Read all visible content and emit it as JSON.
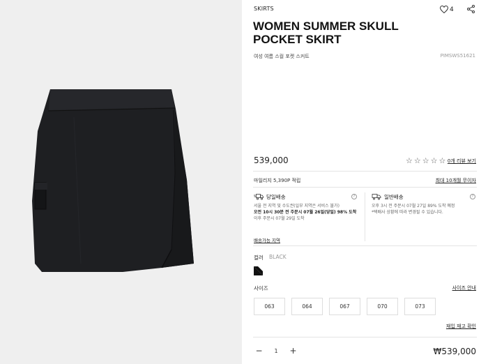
{
  "product": {
    "category": "SKIRTS",
    "wish_count": "4",
    "title_line1": "WOMEN SUMMER SKULL",
    "title_line2": "POCKET SKIRT",
    "subtitle": "여성 여름 스컬 포켓 스커트",
    "sku": "PIMSWS51621",
    "price": "539,000",
    "rating_stars": 0,
    "review_link": "0개 리뷰 보기"
  },
  "benefits": {
    "mileage": "마일리지 5,390P 적립",
    "installment_link": "최대 10개월 무이자"
  },
  "shipping": {
    "same_day": {
      "title": "당일배송",
      "line1": "서울 전 지역 및 수도권(일부 지역은 서비스 불가)",
      "line2": "오전 10시 30분 전 주문시 07월 26일(당일) 98% 도착",
      "line3": "이후 주문시 07월 29일 도착"
    },
    "regular": {
      "title": "일반배송",
      "line1": "오후 3시 전 주문시 07월 27일 89% 도착 예정",
      "line2": "*택배사 상황에 따라 변경될 수 있습니다."
    },
    "region_link": "배송가능 지역"
  },
  "color": {
    "label": "컬러",
    "value": "BLACK",
    "swatch_color": "#111111"
  },
  "size": {
    "label": "사이즈",
    "guide_link": "사이즈 안내",
    "options": [
      "063",
      "064",
      "067",
      "070",
      "073"
    ],
    "restock_link": "재입 재고 확인"
  },
  "purchase": {
    "quantity": "1",
    "minus": "−",
    "plus": "+",
    "total": "₩539,000"
  },
  "icons": {
    "heart": "heart-icon",
    "share": "share-icon",
    "truck_fast": "fast-truck-icon",
    "truck": "truck-icon",
    "info": "info-icon"
  }
}
